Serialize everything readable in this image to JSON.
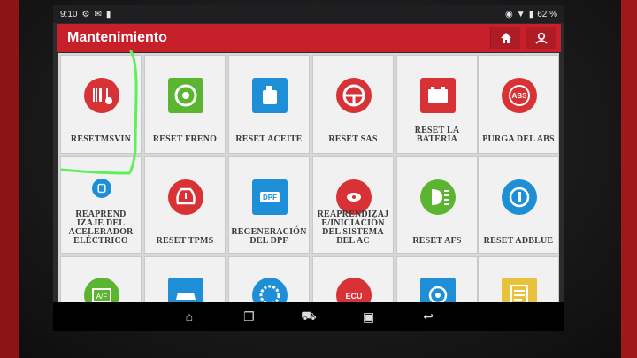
{
  "status": {
    "time": "9:10",
    "battery": "62 %"
  },
  "header": {
    "title": "Mantenimiento"
  },
  "tiles": [
    {
      "label": "RESETMSVIN",
      "icon": "barcode-icon",
      "color": "#d83236"
    },
    {
      "label": "RESET FRENO",
      "icon": "brake-disc-icon",
      "color": "#5cb531"
    },
    {
      "label": "RESET ACEITE",
      "icon": "oil-can-icon",
      "color": "#1e8fd6"
    },
    {
      "label": "RESET SAS",
      "icon": "steering-wheel-icon",
      "color": "#d83236"
    },
    {
      "label": "RESET LA BATERIA",
      "icon": "battery-icon",
      "color": "#d83236"
    },
    {
      "label": "PURGA DEL ABS",
      "icon": "abs-icon",
      "color": "#d83236"
    },
    {
      "label": "REAPREND IZAJE DEL ACELERADOR ELÉCTRICO",
      "icon": "throttle-icon",
      "color": "#1e8fd6"
    },
    {
      "label": "RESET TPMS",
      "icon": "tire-pressure-icon",
      "color": "#d83236"
    },
    {
      "label": "REGENERACIÓN DEL DPF",
      "icon": "dpf-icon",
      "color": "#1e8fd6"
    },
    {
      "label": "REAPRENDIZAJ E/INICIACIÓN DEL SISTEMA DEL AC",
      "icon": "ac-system-icon",
      "color": "#d83236"
    },
    {
      "label": "RESET AFS",
      "icon": "headlight-icon",
      "color": "#5cb531"
    },
    {
      "label": "RESET ADBLUE",
      "icon": "adblue-icon",
      "color": "#1e8fd6"
    },
    {
      "label": "",
      "icon": "air-fuel-icon",
      "color": "#5cb531"
    },
    {
      "label": "",
      "icon": "car-icon",
      "color": "#1e8fd6"
    },
    {
      "label": "",
      "icon": "gear-wheel-icon",
      "color": "#1e8fd6"
    },
    {
      "label": "",
      "icon": "ecu-icon",
      "color": "#d83236"
    },
    {
      "label": "",
      "icon": "turbo-icon",
      "color": "#1e8fd6"
    },
    {
      "label": "",
      "icon": "document-icon",
      "color": "#e8c23a"
    }
  ]
}
